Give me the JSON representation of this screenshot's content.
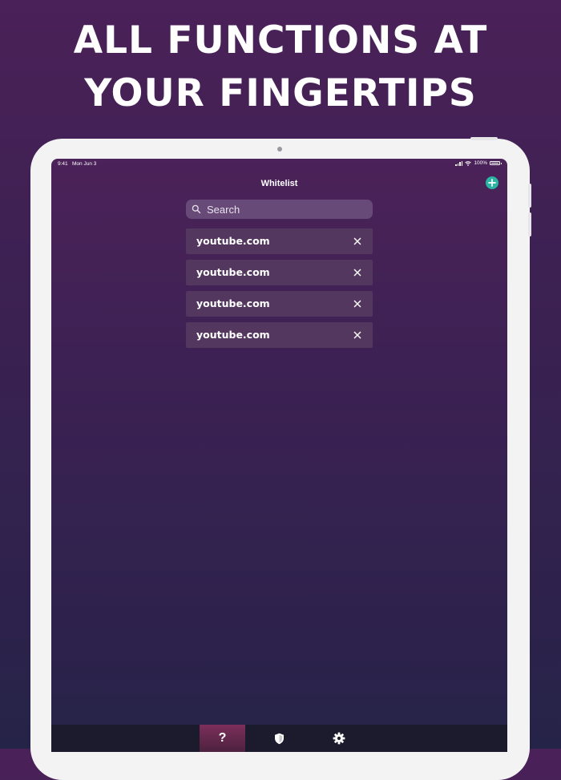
{
  "headline": {
    "line1": "ALL FUNCTIONS AT",
    "line2": "YOUR FINGERTIPS"
  },
  "status_bar": {
    "time": "9:41",
    "date": "Mon Jun 3",
    "battery": "100%"
  },
  "nav": {
    "title": "Whitelist",
    "add_icon": "plus-circle-icon"
  },
  "search": {
    "placeholder": "Search",
    "value": ""
  },
  "whitelist": {
    "items": [
      {
        "label": "youtube.com"
      },
      {
        "label": "youtube.com"
      },
      {
        "label": "youtube.com"
      },
      {
        "label": "youtube.com"
      }
    ],
    "remove_icon": "close-icon"
  },
  "tab_bar": {
    "tabs": [
      {
        "icon": "question-icon",
        "label": "?",
        "selected": true
      },
      {
        "icon": "shield-icon",
        "selected": false
      },
      {
        "icon": "gear-icon",
        "selected": false
      }
    ]
  },
  "colors": {
    "accent": "#2bb3a3",
    "selected_tab": "#7c2f5a",
    "background_top": "#4a2158",
    "background_bottom": "#262348",
    "device_frame": "#f3f3f4"
  }
}
